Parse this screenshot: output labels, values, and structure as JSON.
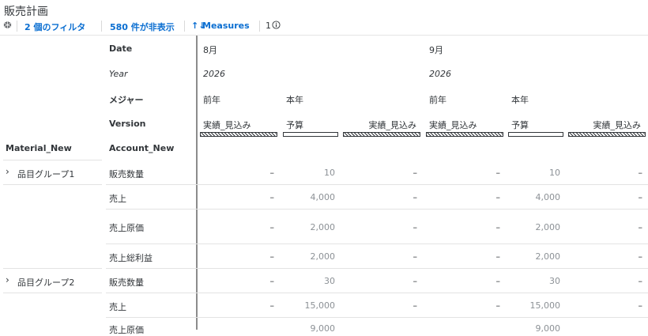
{
  "title": "販売計画",
  "toolbar": {
    "filters": "2 個のフィルタ",
    "hidden": "580 件が非表示",
    "measures": "Measures",
    "count": "1"
  },
  "headers": {
    "date_label": "Date",
    "year_label": "Year",
    "measure_label": "メジャー",
    "version_label": "Version",
    "material_label": "Material_New",
    "account_label": "Account_New"
  },
  "columns": {
    "aug": "8月",
    "sep": "9月",
    "year_aug": "2026",
    "year_sep": "2026",
    "prev_aug": "前年",
    "cur_aug": "本年",
    "prev_sep": "前年",
    "cur_sep": "本年",
    "v1": "実績_見込み",
    "v2": "予算",
    "v3": "実績_見込み",
    "v4": "実績_見込み",
    "v5": "予算",
    "v6": "実績_見込み"
  },
  "rows": [
    {
      "group": "品目グループ1",
      "account": "販売数量",
      "c1": "–",
      "c2": "10",
      "c3": "–",
      "c4": "–",
      "c5": "10",
      "c6": "–"
    },
    {
      "group": "",
      "account": "売上",
      "c1": "–",
      "c2": "4,000",
      "c3": "–",
      "c4": "–",
      "c5": "4,000",
      "c6": "–"
    },
    {
      "group": "",
      "account": "売上原価",
      "c1": "–",
      "c2": "2,000",
      "c3": "–",
      "c4": "–",
      "c5": "2,000",
      "c6": "–"
    },
    {
      "group": "",
      "account": "売上総利益",
      "c1": "–",
      "c2": "2,000",
      "c3": "–",
      "c4": "–",
      "c5": "2,000",
      "c6": "–"
    },
    {
      "group": "品目グループ2",
      "account": "販売数量",
      "c1": "–",
      "c2": "30",
      "c3": "–",
      "c4": "–",
      "c5": "30",
      "c6": "–"
    },
    {
      "group": "",
      "account": "売上",
      "c1": "–",
      "c2": "15,000",
      "c3": "–",
      "c4": "–",
      "c5": "15,000",
      "c6": "–"
    },
    {
      "group": "",
      "account": "売上原価",
      "c1": "",
      "c2": "9,000",
      "c3": "",
      "c4": "",
      "c5": "9,000",
      "c6": ""
    }
  ]
}
